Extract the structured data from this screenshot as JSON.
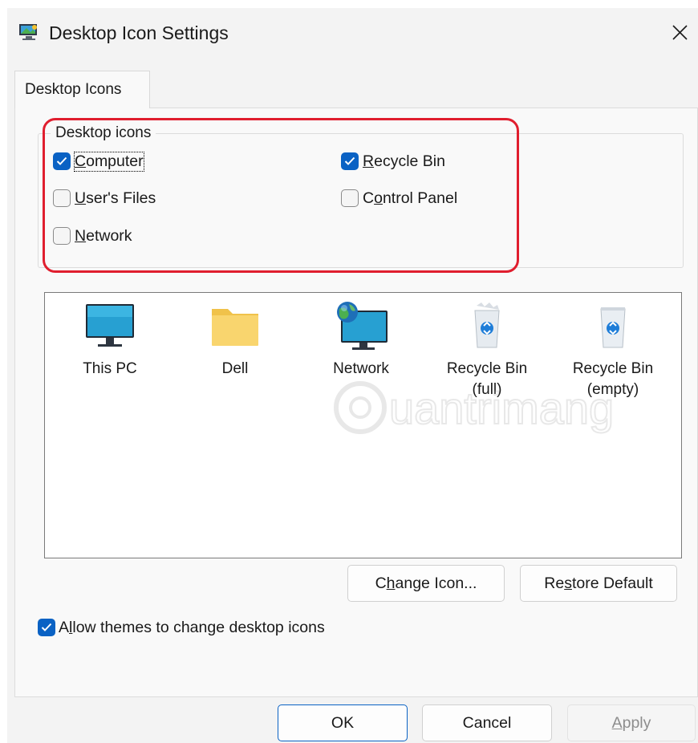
{
  "window": {
    "title": "Desktop Icon Settings",
    "close_glyph": "✕"
  },
  "tabs": [
    {
      "label": "Desktop Icons"
    }
  ],
  "desktop_icons_group": {
    "legend": "Desktop icons",
    "checkboxes": {
      "computer": {
        "pre": "",
        "key": "C",
        "post": "omputer",
        "checked": true
      },
      "recycle_bin": {
        "pre": "",
        "key": "R",
        "post": "ecycle Bin",
        "checked": true
      },
      "users_files": {
        "pre": "",
        "key": "U",
        "post": "ser's Files",
        "checked": false
      },
      "control_panel": {
        "pre": "C",
        "key": "o",
        "post": "ntrol Panel",
        "checked": false
      },
      "network": {
        "pre": "",
        "key": "N",
        "post": "etwork",
        "checked": false
      }
    }
  },
  "icon_list": {
    "items": [
      {
        "line1": "This PC",
        "line2": "",
        "icon": "monitor-icon"
      },
      {
        "line1": "Dell",
        "line2": "",
        "icon": "folder-icon"
      },
      {
        "line1": "Network",
        "line2": "",
        "icon": "network-icon"
      },
      {
        "line1": "Recycle Bin",
        "line2": "(full)",
        "icon": "recycle-bin-full-icon"
      },
      {
        "line1": "Recycle Bin",
        "line2": "(empty)",
        "icon": "recycle-bin-empty-icon"
      }
    ],
    "watermark": "uantrimang"
  },
  "buttons": {
    "change_icon": {
      "pre": "C",
      "key": "h",
      "post": "ange Icon..."
    },
    "restore_default": {
      "pre": "Re",
      "key": "s",
      "post": "tore Default"
    },
    "ok": {
      "label": "OK"
    },
    "cancel": {
      "label": "Cancel"
    },
    "apply": {
      "pre": "",
      "key": "A",
      "post": "pply",
      "disabled": true
    }
  },
  "allow_themes": {
    "pre": "A",
    "key": "l",
    "post": "low themes to change desktop icons",
    "checked": true
  },
  "colors": {
    "accent": "#0a62c4",
    "highlight_outline": "#e01e2e"
  }
}
